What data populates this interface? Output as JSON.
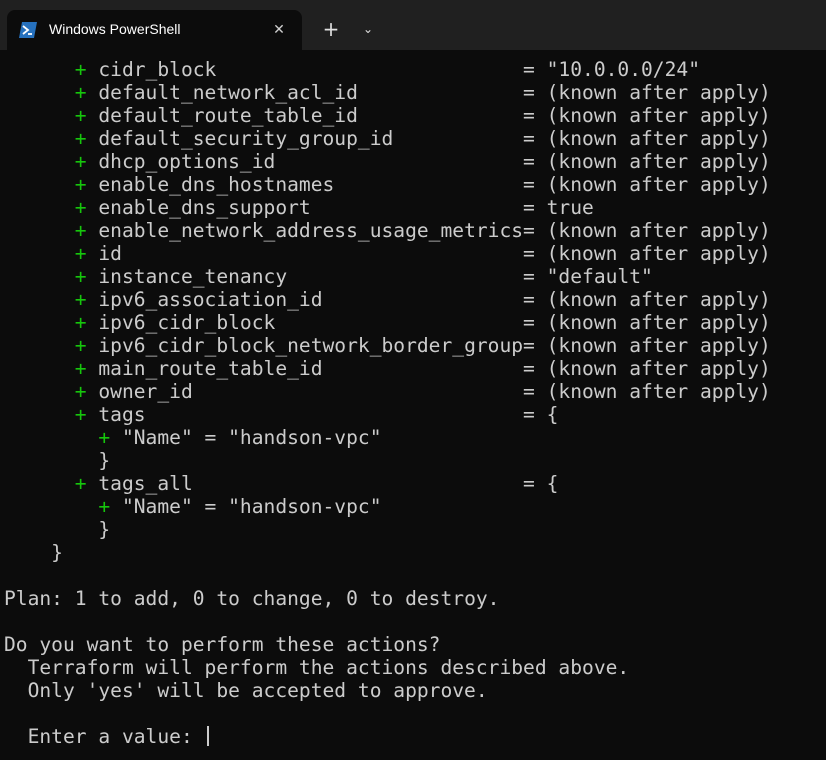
{
  "window": {
    "tab_title": "Windows PowerShell",
    "tab_icon": "powershell-icon",
    "close_icon": "close-icon",
    "new_tab_icon": "plus-icon",
    "dropdown_icon": "chevron-down-icon"
  },
  "colors": {
    "background": "#0c0c0c",
    "titlebar": "#202020",
    "text": "#cccccc",
    "plus": "#16c60c"
  },
  "terminal": {
    "attributes": [
      {
        "sign": "+",
        "name": "cidr_block",
        "value": "\"10.0.0.0/24\""
      },
      {
        "sign": "+",
        "name": "default_network_acl_id",
        "value": "(known after apply)"
      },
      {
        "sign": "+",
        "name": "default_route_table_id",
        "value": "(known after apply)"
      },
      {
        "sign": "+",
        "name": "default_security_group_id",
        "value": "(known after apply)"
      },
      {
        "sign": "+",
        "name": "dhcp_options_id",
        "value": "(known after apply)"
      },
      {
        "sign": "+",
        "name": "enable_dns_hostnames",
        "value": "(known after apply)"
      },
      {
        "sign": "+",
        "name": "enable_dns_support",
        "value": "true"
      },
      {
        "sign": "+",
        "name": "enable_network_address_usage_metrics",
        "value": "(known after apply)"
      },
      {
        "sign": "+",
        "name": "id",
        "value": "(known after apply)"
      },
      {
        "sign": "+",
        "name": "instance_tenancy",
        "value": "\"default\""
      },
      {
        "sign": "+",
        "name": "ipv6_association_id",
        "value": "(known after apply)"
      },
      {
        "sign": "+",
        "name": "ipv6_cidr_block",
        "value": "(known after apply)"
      },
      {
        "sign": "+",
        "name": "ipv6_cidr_block_network_border_group",
        "value": "(known after apply)"
      },
      {
        "sign": "+",
        "name": "main_route_table_id",
        "value": "(known after apply)"
      },
      {
        "sign": "+",
        "name": "owner_id",
        "value": "(known after apply)"
      }
    ],
    "tags_block": {
      "sign": "+",
      "name": "tags",
      "value": "{",
      "entry_sign": "+",
      "entry": "\"Name\" = \"handson-vpc\"",
      "close": "}"
    },
    "tags_all_block": {
      "sign": "+",
      "name": "tags_all",
      "value": "{",
      "entry_sign": "+",
      "entry": "\"Name\" = \"handson-vpc\"",
      "close": "}"
    },
    "resource_close": "}",
    "plan_prefix": "Plan:",
    "plan_summary": " 1 to add, 0 to change, 0 to destroy.",
    "prompt_question": "Do you want to perform these actions?",
    "prompt_line1": "  Terraform will perform the actions described above.",
    "prompt_line2": "  Only 'yes' will be accepted to approve.",
    "input_label": "  Enter a value: ",
    "input_value": ""
  }
}
